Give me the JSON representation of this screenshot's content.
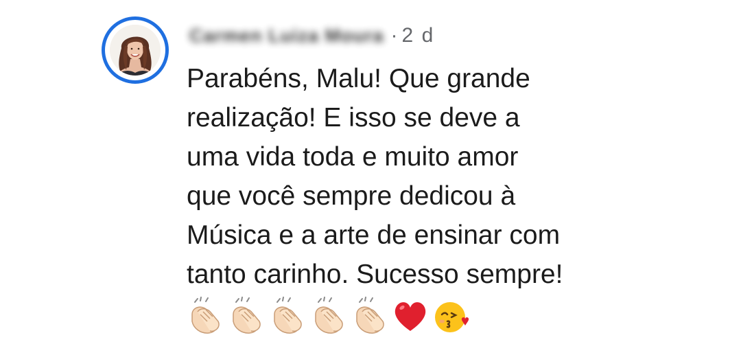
{
  "comment": {
    "author_name": "Carmen Luiza Moura",
    "separator": "·",
    "timestamp": "2 d",
    "text": "Parabéns, Malu! Que grande\nrealização! E isso se deve a\numa vida toda e muito amor\nque você sempre dedicou à\nMúsica e a arte de ensinar com\ntanto carinho. Sucesso sempre!",
    "emojis": [
      "clapping-hands",
      "clapping-hands",
      "clapping-hands",
      "clapping-hands",
      "clapping-hands",
      "red-heart",
      "face-blowing-a-kiss"
    ]
  },
  "colors": {
    "avatar_ring": "#1f6fe0",
    "text": "#1b1b1b",
    "meta": "#65676b"
  }
}
